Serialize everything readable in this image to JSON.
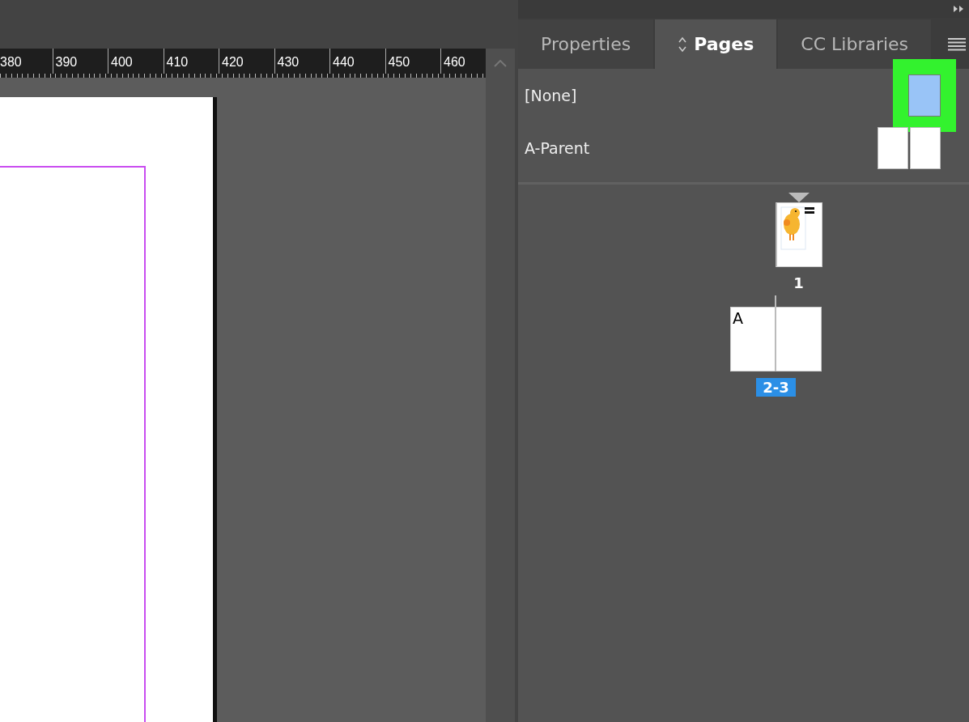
{
  "ruler": {
    "labels": [
      "380",
      "390",
      "400",
      "410",
      "420",
      "430",
      "440",
      "450",
      "460"
    ]
  },
  "panel": {
    "tabs": [
      {
        "label": "Properties",
        "selected": false,
        "kind": "plain"
      },
      {
        "label": "Pages",
        "selected": true,
        "kind": "sortable"
      },
      {
        "label": "CC Libraries",
        "selected": false,
        "kind": "plain"
      }
    ],
    "parents": [
      {
        "label": "[None]",
        "kind": "single",
        "selected": true,
        "highlighted": true
      },
      {
        "label": "A-Parent",
        "kind": "spread",
        "selected": false,
        "highlighted": false
      }
    ],
    "pages": [
      {
        "label": "1",
        "kind": "single",
        "selected": false,
        "current": true
      },
      {
        "label": "2-3",
        "kind": "spread",
        "selected": true,
        "current": false,
        "prefix": "A"
      }
    ]
  }
}
